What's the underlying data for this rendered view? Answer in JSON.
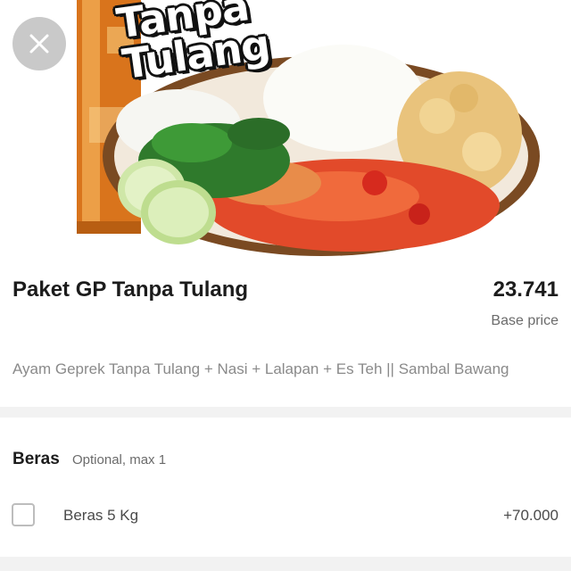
{
  "hero": {
    "overlay_title": "Tanpa\nTulang"
  },
  "product": {
    "name": "Paket GP Tanpa Tulang",
    "price": "23.741",
    "price_label": "Base price",
    "description": "Ayam Geprek Tanpa Tulang + Nasi + Lalapan + Es Teh || Sambal Bawang"
  },
  "option_group": {
    "title": "Beras",
    "hint": "Optional, max 1",
    "options": [
      {
        "label": "Beras 5 Kg",
        "price": "+70.000",
        "checked": false
      }
    ]
  },
  "icons": {
    "close": "close-icon",
    "checkbox": "checkbox-icon"
  },
  "colors": {
    "close_button_bg": "#c9c9c9",
    "divider": "#f2f2f2",
    "muted_text": "#8a8a8a"
  }
}
